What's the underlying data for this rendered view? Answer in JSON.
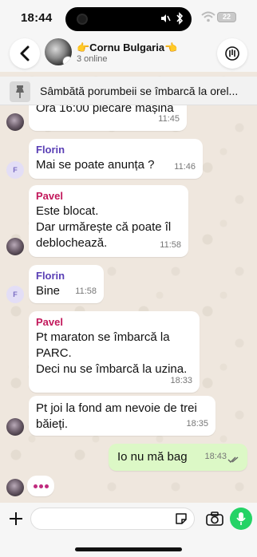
{
  "status": {
    "time": "18:44",
    "battery": "22"
  },
  "header": {
    "title": "👉Cornu Bulgaria👈",
    "subtitle": "3 online"
  },
  "pinned": {
    "text": "Sâmbătă porumbeii se îmbarcă la orel..."
  },
  "messages": [
    {
      "text": "Ora 16:00 plecare mașina",
      "time": "11:45"
    },
    {
      "sender": "Florin",
      "text": "Mai se poate anunța ?",
      "time": "11:46"
    },
    {
      "sender": "Pavel",
      "lines": [
        "Este blocat.",
        "Dar urmărește că poate îl",
        "deblochează."
      ],
      "time": "11:58"
    },
    {
      "sender": "Florin",
      "text": "Bine",
      "time": "11:58"
    },
    {
      "sender": "Pavel",
      "lines": [
        "Pt maraton se îmbarcă la",
        "PARC.",
        "Deci nu se îmbarcă la uzina."
      ],
      "time": "18:33"
    },
    {
      "lines": [
        "Pt joi la fond am nevoie de trei",
        "băieți."
      ],
      "time": "18:35"
    },
    {
      "text": "Io nu mă bag",
      "time": "18:43"
    }
  ],
  "avatars": {
    "florin_initial": "F"
  },
  "colors": {
    "florin": "#5a3fb5",
    "pavel": "#c2185b",
    "mine_bubble": "#dcf8c6",
    "mic": "#25d366"
  }
}
